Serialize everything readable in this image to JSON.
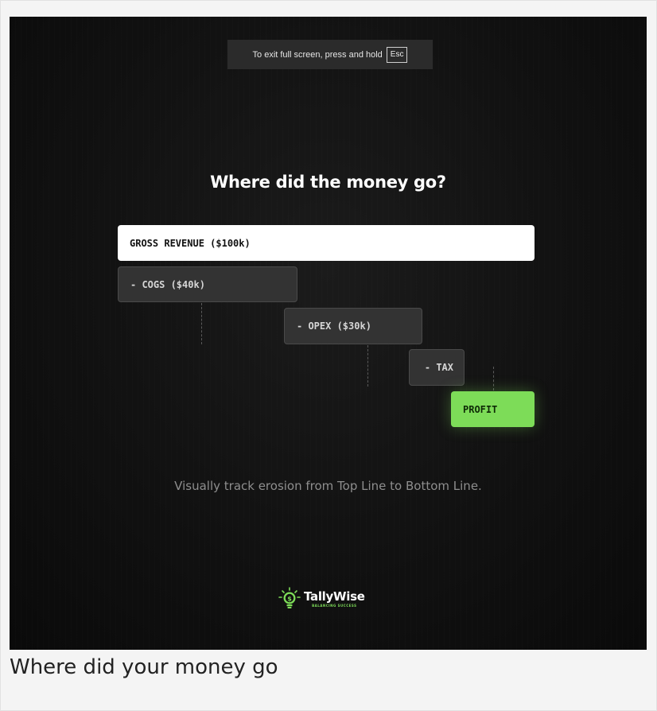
{
  "fullscreen_banner": {
    "message": "To exit full screen, press and hold",
    "key": "Esc"
  },
  "headline": "Where did the money go?",
  "waterfall": {
    "revenue": "GROSS REVENUE ($100k)",
    "cogs": "- COGS ($40k)",
    "opex": "- OPEX ($30k)",
    "tax": "- TAX",
    "profit": "PROFIT"
  },
  "tagline": "Visually track erosion from Top Line to Bottom Line.",
  "logo": {
    "name": "TallyWise",
    "tagline": "BALANCING SUCCESS",
    "icon": "lightbulb-dollar-icon"
  },
  "caption": "Where did your money go",
  "colors": {
    "accent": "#7ddc58",
    "background": "#111111",
    "bar_white": "#ffffff",
    "bar_dark": "#333333"
  }
}
